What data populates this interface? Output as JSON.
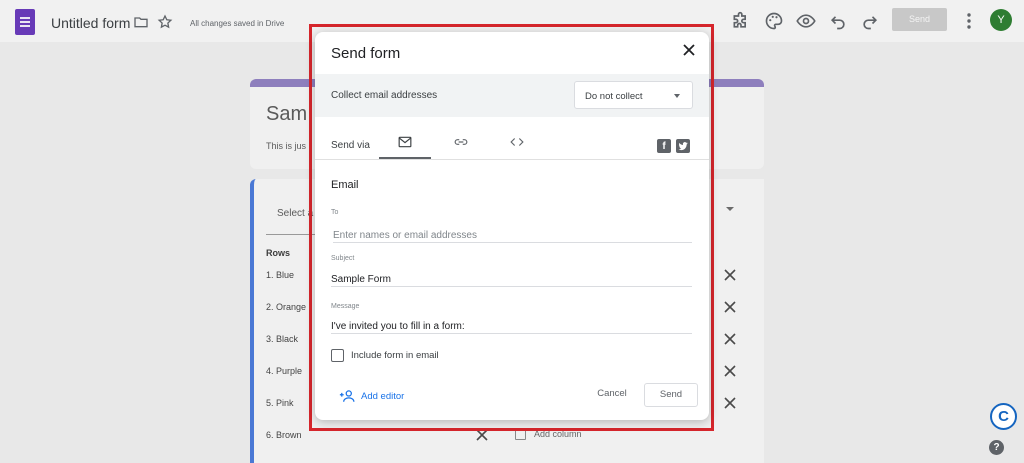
{
  "app": {
    "doc_title": "Untitled form",
    "save_status": "All changes saved in Drive",
    "send_label": "Send",
    "avatar_initial": "Y"
  },
  "background_form": {
    "title": "Sam",
    "description": "This is jus",
    "select_label": "Select a",
    "rows_label": "Rows",
    "rows": [
      "1.  Blue",
      "2.  Orange",
      "3.  Black",
      "4.  Purple",
      "5.  Pink",
      "6.  Brown"
    ],
    "add_column": "Add column"
  },
  "dialog": {
    "title": "Send form",
    "collect_label": "Collect email addresses",
    "collect_value": "Do not collect",
    "send_via": "Send via",
    "email_heading": "Email",
    "to_label": "To",
    "to_placeholder": "Enter names or email addresses",
    "subject_label": "Subject",
    "subject_value": "Sample Form",
    "message_label": "Message",
    "message_value": "I've invited you to fill in a form:",
    "include_form": "Include form in email",
    "add_editor": "Add editor",
    "cancel": "Cancel",
    "send": "Send"
  },
  "corner": {
    "badge": "C",
    "help": "?"
  },
  "colors": {
    "forms_purple": "#673ab7",
    "accent_blue": "#1a73e8",
    "highlight_red": "#d6262c",
    "avatar_green": "#2e7d32"
  }
}
